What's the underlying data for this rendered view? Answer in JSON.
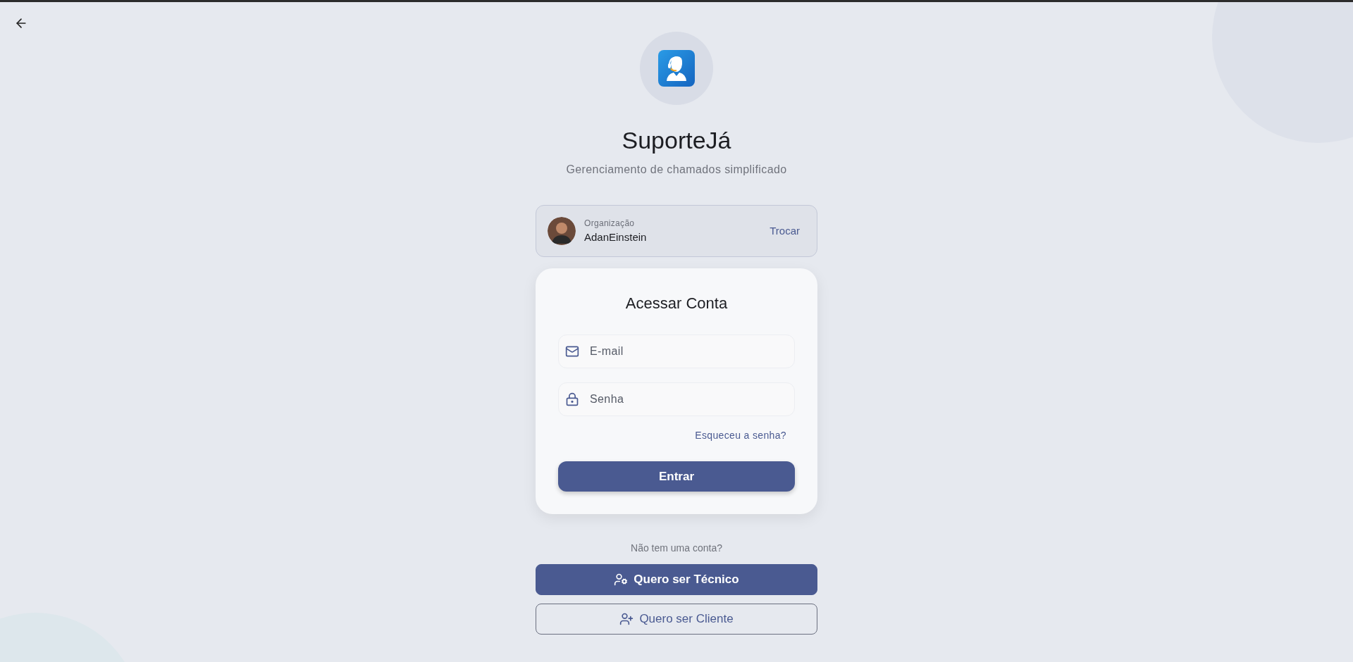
{
  "brand": {
    "title": "SuporteJá",
    "subtitle": "Gerenciamento de chamados simplificado"
  },
  "organization": {
    "label": "Organização",
    "name": "AdanEinstein",
    "action": "Trocar"
  },
  "login": {
    "title": "Acessar Conta",
    "fields": [
      {
        "kind": "email",
        "placeholder": "E-mail"
      },
      {
        "kind": "password",
        "placeholder": "Senha"
      }
    ],
    "forgot_link": "Esqueceu a senha?",
    "submit": "Entrar"
  },
  "signup": {
    "prompt": "Não tem uma conta?",
    "buttons": [
      {
        "kind": "primary",
        "label": "Quero ser Técnico"
      },
      {
        "kind": "outline",
        "label": "Quero ser Cliente"
      }
    ]
  }
}
